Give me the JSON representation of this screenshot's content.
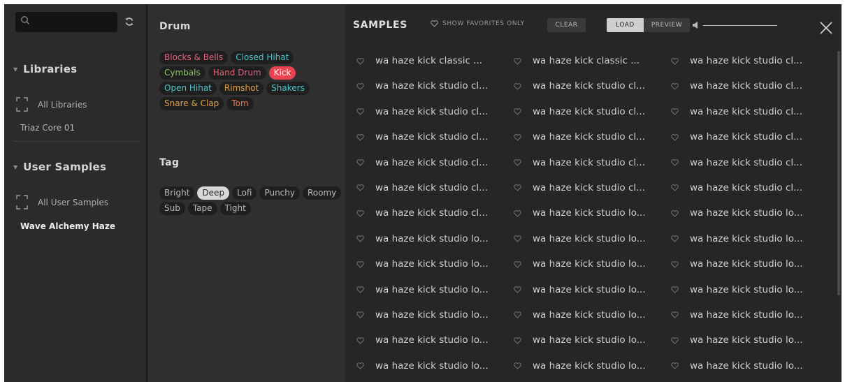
{
  "sidebar": {
    "search_placeholder": "",
    "libraries_title": "Libraries",
    "all_libraries": "All Libraries",
    "triaz": "Triaz Core 01",
    "user_samples_title": "User Samples",
    "all_user_samples": "All User Samples",
    "wave_alchemy": "Wave Alchemy Haze"
  },
  "drum": {
    "title": "Drum",
    "chips": [
      {
        "label": "Blocks & Bells",
        "color": "#e0607a",
        "selected": false
      },
      {
        "label": "Closed Hihat",
        "color": "#4fc3c9",
        "selected": false
      },
      {
        "label": "Cymbals",
        "color": "#8cc46a",
        "selected": false
      },
      {
        "label": "Hand Drum",
        "color": "#e0607a",
        "selected": false
      },
      {
        "label": "Kick",
        "color": "#ffffff",
        "selected": true
      },
      {
        "label": "Open Hihat",
        "color": "#4fc3c9",
        "selected": false
      },
      {
        "label": "Rimshot",
        "color": "#e0a24a",
        "selected": false
      },
      {
        "label": "Shakers",
        "color": "#4fc3c9",
        "selected": false
      },
      {
        "label": "Snare & Clap",
        "color": "#e0a24a",
        "selected": false
      },
      {
        "label": "Tom",
        "color": "#e07a4a",
        "selected": false
      }
    ]
  },
  "tag": {
    "title": "Tag",
    "chips": [
      {
        "label": "Bright",
        "selected": false
      },
      {
        "label": "Deep",
        "selected": true
      },
      {
        "label": "Lofi",
        "selected": false
      },
      {
        "label": "Punchy",
        "selected": false
      },
      {
        "label": "Roomy",
        "selected": false
      },
      {
        "label": "Sub",
        "selected": false
      },
      {
        "label": "Tape",
        "selected": false
      },
      {
        "label": "Tight",
        "selected": false
      }
    ]
  },
  "samples": {
    "title": "SAMPLES",
    "show_favorites": "SHOW FAVORITES ONLY",
    "clear": "CLEAR",
    "load": "LOAD",
    "preview": "PREVIEW",
    "rows": [
      [
        "wa haze kick classic ...",
        "wa haze kick classic ...",
        "wa haze kick studio cl..."
      ],
      [
        "wa haze kick studio cl...",
        "wa haze kick studio cl...",
        "wa haze kick studio cl..."
      ],
      [
        "wa haze kick studio cl...",
        "wa haze kick studio cl...",
        "wa haze kick studio cl..."
      ],
      [
        "wa haze kick studio cl...",
        "wa haze kick studio cl...",
        "wa haze kick studio cl..."
      ],
      [
        "wa haze kick studio cl...",
        "wa haze kick studio cl...",
        "wa haze kick studio cl..."
      ],
      [
        "wa haze kick studio cl...",
        "wa haze kick studio cl...",
        "wa haze kick studio cl..."
      ],
      [
        "wa haze kick studio cl...",
        "wa haze kick studio lo...",
        "wa haze kick studio lo..."
      ],
      [
        "wa haze kick studio lo...",
        "wa haze kick studio lo...",
        "wa haze kick studio lo..."
      ],
      [
        "wa haze kick studio lo...",
        "wa haze kick studio lo...",
        "wa haze kick studio lo..."
      ],
      [
        "wa haze kick studio lo...",
        "wa haze kick studio lo...",
        "wa haze kick studio lo..."
      ],
      [
        "wa haze kick studio lo...",
        "wa haze kick studio lo...",
        "wa haze kick studio lo..."
      ],
      [
        "wa haze kick studio lo...",
        "wa haze kick studio lo...",
        "wa haze kick studio lo..."
      ],
      [
        "wa haze kick studio lo...",
        "wa haze kick studio lo...",
        "wa haze kick studio lo..."
      ]
    ]
  },
  "colors": {
    "accent_red": "#e8434f",
    "panel_bg": "#2e2e2e",
    "list_bg": "#262626"
  }
}
